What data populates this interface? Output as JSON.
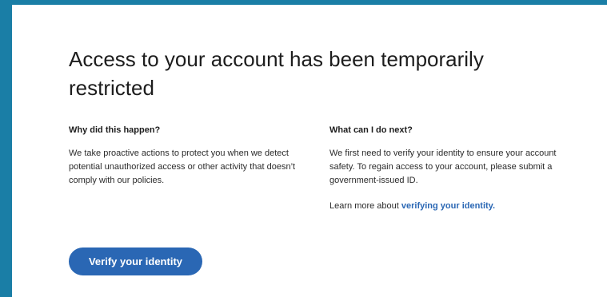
{
  "page": {
    "title": "Access to your account has been temporarily restricted"
  },
  "left_column": {
    "heading": "Why did this happen?",
    "body": "We take proactive actions to protect you when we detect potential unauthorized access or other activity that doesn’t comply with our policies."
  },
  "right_column": {
    "heading": "What can I do next?",
    "body": "We first need to verify your identity to ensure your account safety. To regain access to your account, please submit a government-issued ID.",
    "learn_prefix": "Learn more about ",
    "learn_link": "verifying your identity."
  },
  "actions": {
    "verify_label": "Verify your identity"
  },
  "colors": {
    "accent": "#2a67b4",
    "frame": "#1a7ea6"
  }
}
